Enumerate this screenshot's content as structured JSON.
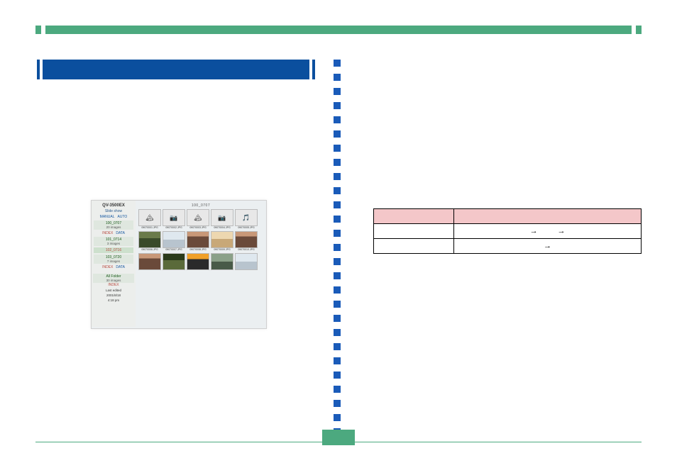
{
  "section": "",
  "screenshot": {
    "title": "QV-3500EX",
    "slide_show": "Slide show",
    "manual": "MANUAL",
    "auto": "AUTO",
    "folders": [
      {
        "name": "100_0707",
        "sub": "20 images",
        "index": "INDEX",
        "data": "DATA"
      },
      {
        "name": "101_0714",
        "sub": "3 images"
      },
      {
        "name": "102_0716",
        "sub": ""
      },
      {
        "name": "103_0720",
        "sub": "7 images",
        "index": "INDEX",
        "data": "DATA"
      }
    ],
    "all_folder": {
      "label": "All Folder",
      "sub": "30 images",
      "index": "INDEX"
    },
    "last_edited": "Last edited",
    "date": "2001/8/18",
    "time": "4:18 pm",
    "main_head": "100_0707",
    "thumb_labels": [
      "09070001.JPG",
      "09070002.JPG",
      "09070003.JPG",
      "09070004.JPG",
      "09070005.JPG",
      "09070006.JPG",
      "09070007.JPG",
      "09070008.JPG",
      "09070009.JPG",
      "09070010.JPG"
    ],
    "icon_rows": [
      [
        "🏔",
        "📷",
        "🎵"
      ]
    ]
  },
  "table": {
    "header": [
      "",
      ""
    ],
    "row1": [
      "",
      "→            →"
    ],
    "row2": [
      "",
      "→"
    ]
  },
  "page": ""
}
